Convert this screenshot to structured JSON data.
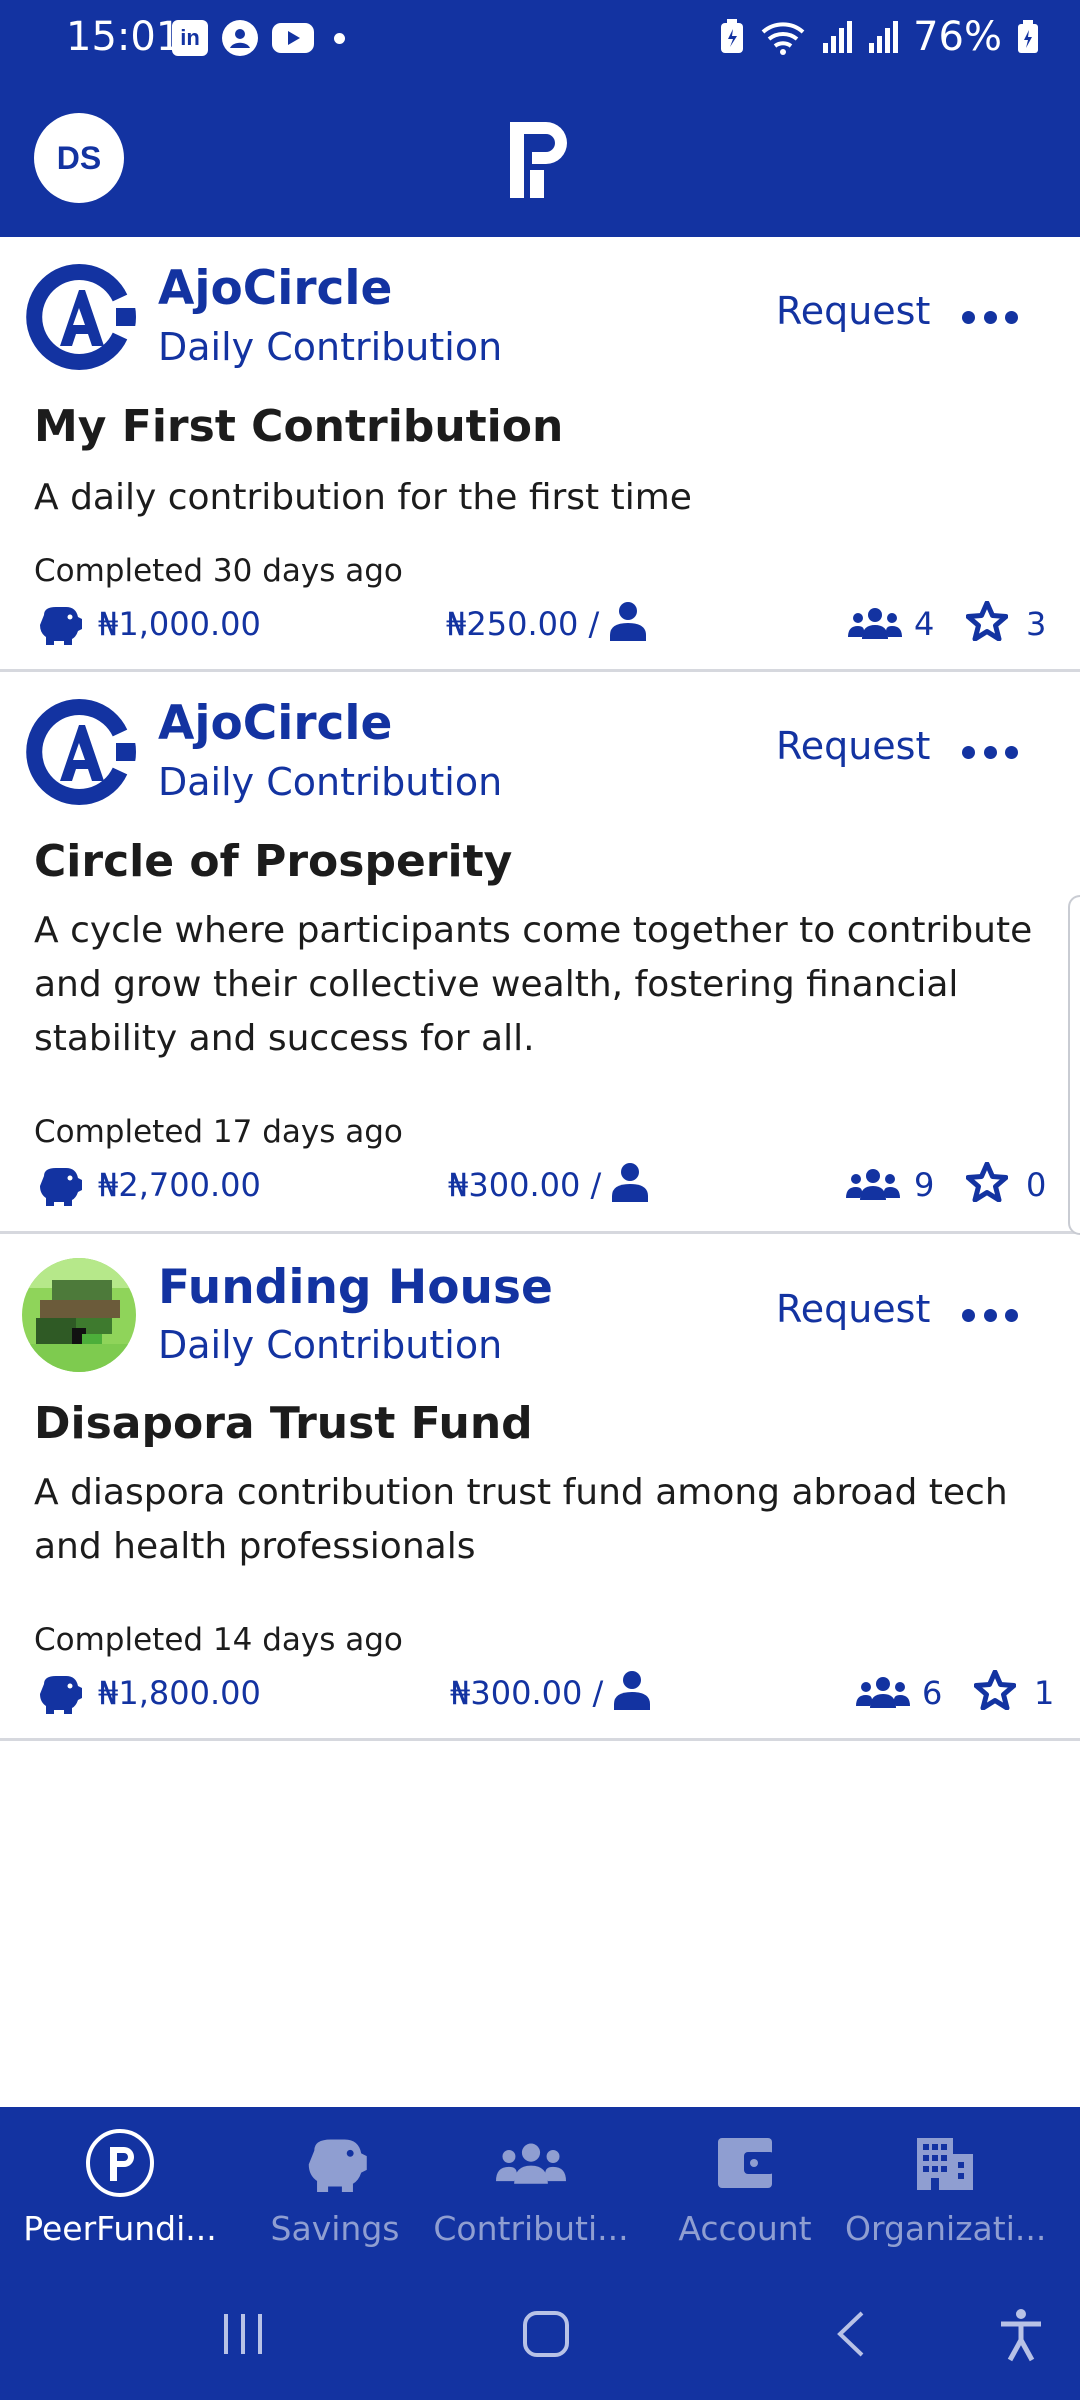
{
  "status_bar": {
    "time": "15:01",
    "battery": "76%",
    "left_icons": [
      "linkedin-icon",
      "account-circle-icon",
      "youtube-icon",
      "notification-dot-icon"
    ],
    "right_icons": [
      "battery-saver-icon",
      "wifi-icon",
      "signal-icon",
      "signal-icon",
      "battery-icon"
    ]
  },
  "header": {
    "avatar_initials": "DS",
    "logo": "peerfunding-p-logo"
  },
  "colors": {
    "brand": "#1333A1",
    "text": "#1c1c1c",
    "inactive_nav": "#8f9ed1",
    "divider": "#d6d8de"
  },
  "feed": [
    {
      "org_name": "AjoCircle",
      "org_type": "Daily Contribution",
      "request_label": "Request",
      "title": "My First Contribution",
      "description": "A daily contribution for the first time",
      "completed": "Completed 30 days ago",
      "total": "₦1,000.00",
      "per_person": "₦250.00 /",
      "members": "4",
      "stars": "3"
    },
    {
      "org_name": "AjoCircle",
      "org_type": "Daily Contribution",
      "request_label": "Request",
      "title": "Circle of Prosperity",
      "description": "A cycle where participants come together to contribute and grow their collective wealth, fostering financial stability and success for all.",
      "completed": "Completed 17 days ago",
      "total": "₦2,700.00",
      "per_person": "₦300.00 /",
      "members": "9",
      "stars": "0"
    },
    {
      "org_name": "Funding House",
      "org_type": "Daily Contribution",
      "request_label": "Request",
      "title": "Disapora Trust Fund",
      "description": "A diaspora contribution trust fund among abroad tech and health professionals",
      "completed": "Completed 14 days ago",
      "total": "₦1,800.00",
      "per_person": "₦300.00 /",
      "members": "6",
      "stars": "1"
    }
  ],
  "bottom_nav": [
    {
      "label": "PeerFundi...",
      "icon": "peerfunding-icon",
      "active": true
    },
    {
      "label": "Savings",
      "icon": "piggy-bank-icon",
      "active": false
    },
    {
      "label": "Contributi...",
      "icon": "group-icon",
      "active": false
    },
    {
      "label": "Account",
      "icon": "wallet-icon",
      "active": false
    },
    {
      "label": "Organizati...",
      "icon": "building-icon",
      "active": false
    }
  ],
  "system_nav": [
    "recents-icon",
    "home-icon",
    "back-icon",
    "accessibility-icon"
  ]
}
